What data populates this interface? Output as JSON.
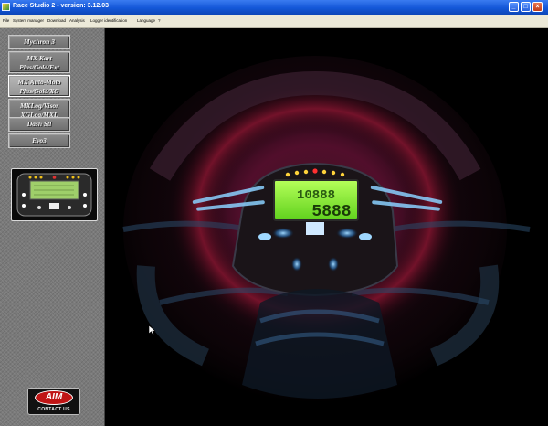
{
  "window": {
    "title": "Race Studio 2  -  version: 3.12.03"
  },
  "menu": {
    "items": [
      "File",
      "System manager",
      "Download",
      "Analysis",
      "Logger identification",
      "Language",
      "?"
    ]
  },
  "sidebar": {
    "buttons": [
      {
        "label": "Mychron 3"
      },
      {
        "label_line1": "MX Kart",
        "label_line2": "Plus/Gold/Ext"
      },
      {
        "label_line1": "MX Auto-Moto",
        "label_line2": "Plus/Gold/XG"
      },
      {
        "label_line1": "MXLog/Visor",
        "label_line2": "XGLog/MXL"
      },
      {
        "label": "Dash Stl"
      },
      {
        "label": "Evo3"
      }
    ],
    "logo": {
      "brand": "AIM",
      "caption": "CONTACT US"
    }
  },
  "display": {
    "digits": "5888",
    "top_digits": "10888"
  },
  "colors": {
    "titlebar": "#1457d8",
    "menubar": "#ece9d8",
    "sidebar": "#7a7a7a",
    "lcd": "#7cff3a",
    "glow": "#c0305a"
  }
}
